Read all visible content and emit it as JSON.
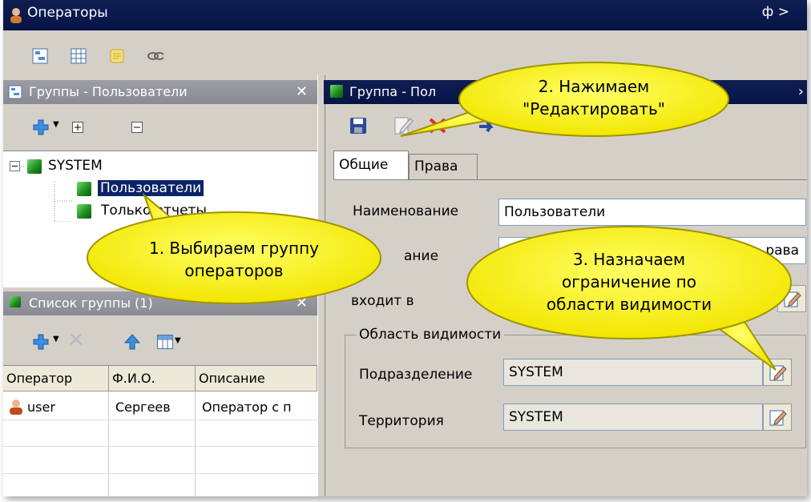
{
  "window": {
    "title": "Операторы",
    "pin_glyph": "ф",
    "close_glyph": ">"
  },
  "main_toolbar": {
    "icons": [
      "tree-view-icon",
      "grid-view-icon",
      "notes-icon",
      "link-icon"
    ]
  },
  "groups_panel": {
    "title": "Группы - Пользователи",
    "toolbar": {
      "add_icon": "add-icon",
      "expand_icon": "expand-all-icon",
      "collapse_icon": "collapse-all-icon"
    },
    "tree": {
      "root": "SYSTEM",
      "children": [
        "Пользователи",
        "Только отчеты"
      ],
      "selected": "Пользователи"
    }
  },
  "group_list_panel": {
    "title": "Список группы (1)",
    "columns": [
      "Оператор",
      "Ф.И.О.",
      "Описание"
    ],
    "rows": [
      {
        "operator": "user",
        "fio": "Сергеев",
        "description": "Оператор с п"
      }
    ]
  },
  "group_panel": {
    "title": "Группа - Пол",
    "tabs": [
      "Общие",
      "Права"
    ],
    "active_tab": "Общие",
    "fields": {
      "name_label": "Наименование",
      "name_value": "Пользователи",
      "desc_label": "ание",
      "desc_value": "рава",
      "member_label": "входит в"
    },
    "visibility": {
      "legend": "Область видимости",
      "division_label": "Подразделение",
      "division_value": "SYSTEM",
      "territory_label": "Территория",
      "territory_value": "SYSTEM"
    }
  },
  "callouts": [
    {
      "line1": "1. Выбираем группу",
      "line2": "операторов"
    },
    {
      "line1": "2. Нажимаем",
      "line2": "\"Редактировать\""
    },
    {
      "line1": "3. Назначаем",
      "line2": "ограничение по",
      "line3": "области видимости"
    }
  ],
  "colors": {
    "titlebar": "#061345",
    "callout_fill": "#ffff00",
    "selection": "#0a2468",
    "panel_bg": "#d4d0c8"
  }
}
